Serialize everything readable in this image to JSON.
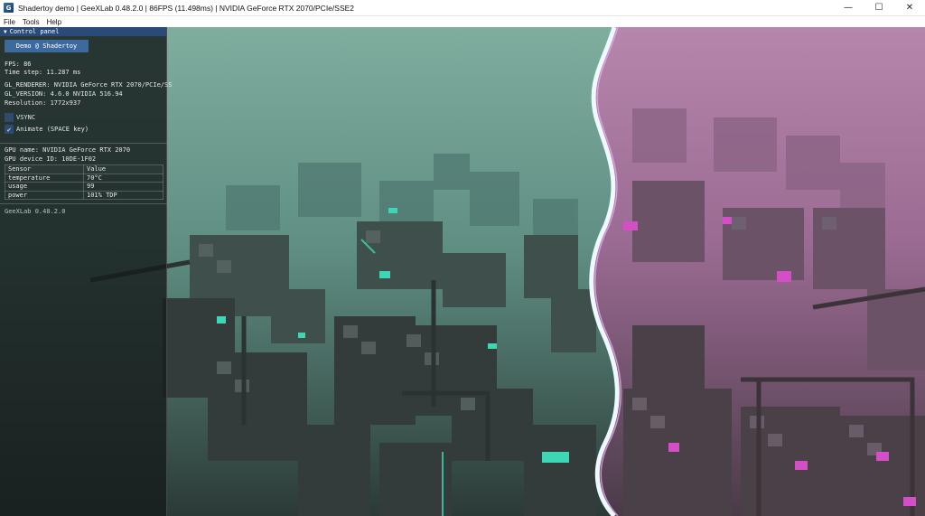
{
  "window": {
    "title": "Shadertoy demo | GeeXLab 0.48.2.0 | 86FPS (11.498ms) | NVIDIA GeForce RTX 2070/PCIe/SSE2",
    "icon": "geexlab-app-icon",
    "minimize_glyph": "—",
    "maximize_glyph": "☐",
    "close_glyph": "✕"
  },
  "menu": {
    "items": [
      "File",
      "Tools",
      "Help"
    ]
  },
  "panel": {
    "header": "Control panel",
    "header_arrow": "▼",
    "demo_button": "Demo @ Shadertoy",
    "fps": "FPS: 86",
    "time_step": "Time step: 11.287 ms",
    "gl_renderer": "GL_RENDERER: NVIDIA GeForce RTX 2070/PCIe/SS",
    "gl_version": "GL_VERSION: 4.6.0 NVIDIA 516.94",
    "resolution": "Resolution: 1772x937",
    "vsync": {
      "label": "VSYNC",
      "checked": false
    },
    "animate": {
      "label": "Animate (SPACE key)",
      "checked": true,
      "glyph": "✔"
    },
    "gpu_name": "GPU name: NVIDIA GeForce RTX 2070",
    "gpu_device_id": "GPU device ID: 10DE-1F02",
    "sensor_table": {
      "headers": [
        "Sensor",
        "Value"
      ],
      "rows": [
        [
          "temperature",
          "70°C"
        ],
        [
          "usage",
          "99"
        ],
        [
          "power",
          "101% TDP"
        ]
      ]
    },
    "footer_version": "GeeXLab 0.48.2.0"
  },
  "colors": {
    "panel_header": "#2a4b77",
    "demo_button": "#3d6a9e",
    "scene_left_fog": "#6f9c90",
    "scene_right_fog": "#a87aa2",
    "accent_teal": "#3fd6b5",
    "accent_magenta": "#d44fc6",
    "wave_divider": "#f0f8ff"
  }
}
